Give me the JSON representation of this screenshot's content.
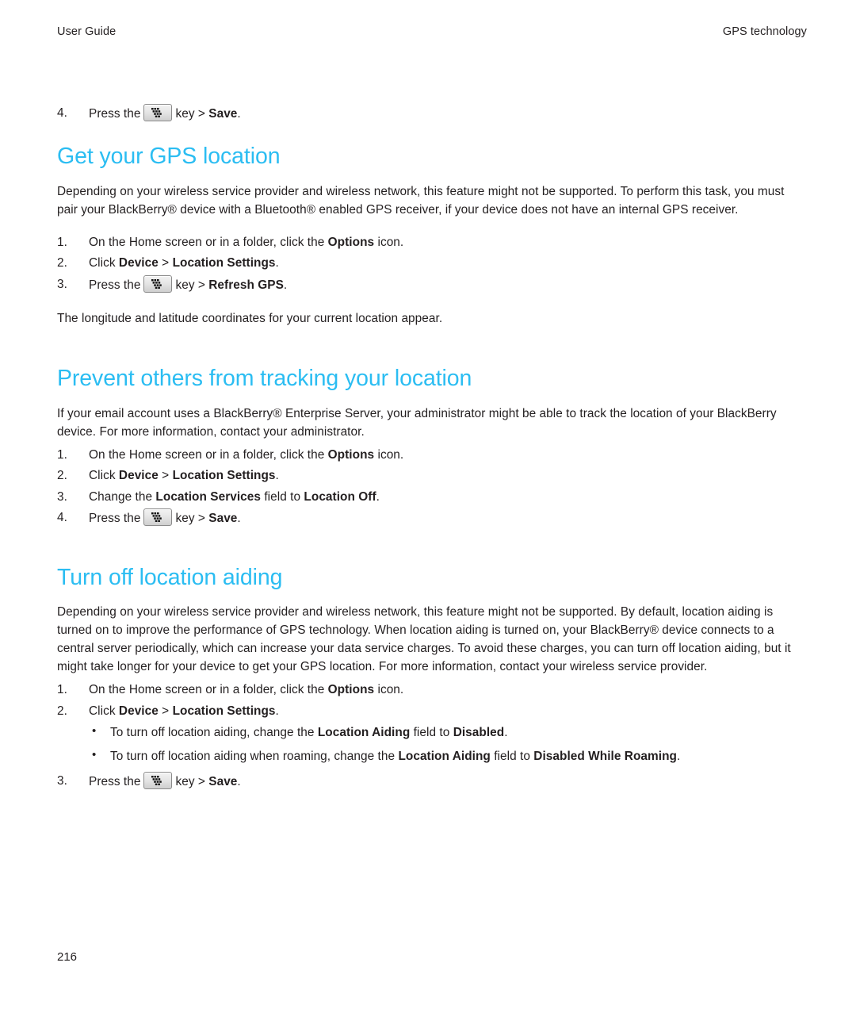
{
  "document": {
    "header_left": "User Guide",
    "header_right": "GPS technology",
    "page_number": "216",
    "heading_color": "#2bbdf2",
    "text_color": "#231f20"
  },
  "intro_step": {
    "num": "4.",
    "pre": "Press the",
    "icon": "blackberry-menu-key-icon",
    "mid": "key >",
    "bold": "Save",
    "end": "."
  },
  "sections": [
    {
      "heading": "Get your GPS location",
      "intro": "Depending on your wireless service provider and wireless network, this feature might not be supported. To perform this task, you must pair your BlackBerry® device with a Bluetooth® enabled GPS receiver, if your device does not have an internal GPS receiver.",
      "steps": [
        {
          "num": "1.",
          "pre": "On the Home screen or in a folder, click the ",
          "bold1": "Options",
          "mid": " icon.",
          "bold2": "",
          "end": ""
        },
        {
          "num": "2.",
          "pre": "Click ",
          "bold1": "Device",
          "mid": " > ",
          "bold2": "Location Settings",
          "end": "."
        },
        {
          "num": "3.",
          "pre": "Press the",
          "icon": "blackberry-menu-key-icon",
          "mid": "key > ",
          "bold2": "Refresh GPS",
          "end": "."
        }
      ],
      "outro": "The longitude and latitude coordinates for your current location appear."
    },
    {
      "heading": "Prevent others from tracking your location",
      "intro": "If your email account uses a BlackBerry® Enterprise Server, your administrator might be able to track the location of your BlackBerry device. For more information, contact your administrator.",
      "steps": [
        {
          "num": "1.",
          "pre": "On the Home screen or in a folder, click the ",
          "bold1": "Options",
          "mid": " icon.",
          "bold2": "",
          "end": ""
        },
        {
          "num": "2.",
          "pre": "Click ",
          "bold1": "Device",
          "mid": " > ",
          "bold2": "Location Settings",
          "end": "."
        },
        {
          "num": "3.",
          "pre": "Change the ",
          "bold1": "Location Services",
          "mid": " field to ",
          "bold2": "Location Off",
          "end": "."
        },
        {
          "num": "4.",
          "pre": "Press the",
          "icon": "blackberry-menu-key-icon",
          "mid": "key > ",
          "bold2": "Save",
          "end": "."
        }
      ],
      "outro": ""
    },
    {
      "heading": "Turn off location aiding",
      "intro": "Depending on your wireless service provider and wireless network, this feature might not be supported. By default, location aiding is turned on to improve the performance of GPS technology. When location aiding is turned on, your BlackBerry® device connects to a central server periodically, which can increase your data service charges. To avoid these charges, you can turn off location aiding, but it might take longer for your device to get your GPS location. For more information, contact your wireless service provider.",
      "steps": [
        {
          "num": "1.",
          "pre": "On the Home screen or in a folder, click the ",
          "bold1": "Options",
          "mid": " icon.",
          "bold2": "",
          "end": ""
        },
        {
          "num": "2.",
          "pre": "Click ",
          "bold1": "Device",
          "mid": " > ",
          "bold2": "Location Settings",
          "end": "."
        },
        {
          "num": "3.",
          "pre": "Press the",
          "icon": "blackberry-menu-key-icon",
          "mid": "key > ",
          "bold2": "Save",
          "end": "."
        }
      ],
      "bullets": [
        {
          "bullet": "•",
          "pre": "To turn off location aiding, change the ",
          "bold1": "Location Aiding",
          "mid": " field to ",
          "bold2": "Disabled",
          "end": "."
        },
        {
          "bullet": "•",
          "pre": "To turn off location aiding when roaming, change the ",
          "bold1": "Location Aiding",
          "mid": " field to ",
          "bold2": "Disabled While Roaming",
          "end": "."
        }
      ],
      "outro": ""
    }
  ]
}
